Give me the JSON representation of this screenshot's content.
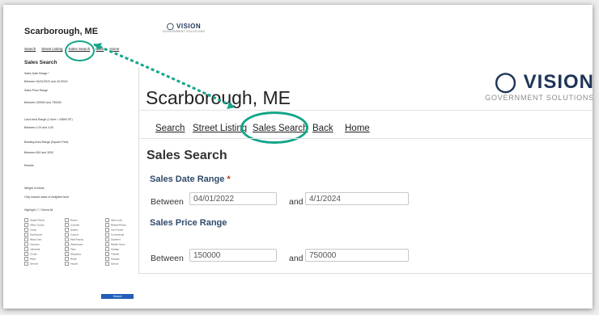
{
  "page": {
    "title": "Scarborough, ME"
  },
  "logo": {
    "brand": "VISION",
    "tagline": "GOVERNMENT SOLUTIONS"
  },
  "nav": {
    "items": [
      "Search",
      "Street Listing",
      "Sales Search",
      "Back",
      "Home"
    ],
    "highlighted": "Sales Search"
  },
  "form": {
    "section_title": "Sales Search",
    "date_range": {
      "label": "Sales Date Range",
      "required_mark": "*",
      "between_label": "Between",
      "and_label": "and",
      "from": "04/01/2022",
      "to": "4/1/2024"
    },
    "price_range": {
      "label": "Sales Price Range",
      "between_label": "Between",
      "and_label": "and",
      "from": "150000",
      "to": "750000"
    }
  },
  "mini": {
    "title": "Scarborough, ME",
    "nav": [
      "Search",
      "Street Listing",
      "Sales Search",
      "Back",
      "Home"
    ],
    "section_title": "Sales Search",
    "rows": [
      "Sales Date Range *",
      "Between  04/01/2022  and  4/1/2024",
      "Sales Price Range",
      "Between  150000  and  750000",
      "Land Area Range (1 Acre = 43560 SF)",
      "Between  1.00  and  4.00",
      "Building Area Range (Square Feet)",
      "Between  500  and  3000",
      "Results",
      "Weight of Areas",
      "Only include sales of weighted land",
      "Highlight / ☐ Check All"
    ],
    "checkboxes": [
      "Single Family",
      "Ranch",
      "Split Level",
      "Cape Cod",
      "Bungalow",
      "Office Condo",
      "Colonial",
      "Raised Ranch",
      "Post Frame",
      "Contemporary",
      "Camp",
      "Duplex",
      "Two Family",
      "Garrison",
      "Cottage",
      "Townhouse",
      "Custom",
      "Commercial",
      "Conventional",
      "Old Style",
      "Mixed Use",
      "Multi Family",
      "Gambrel",
      "Store",
      "Row End",
      "Victorian",
      "Warehouse",
      "Mobile Home",
      "Cabin",
      "Apartment",
      "Industrial",
      "Farm",
      "Garage",
      "Two Story",
      "Cluster",
      "Condo",
      "Shopping",
      "Theater",
      "Hotel",
      "Marina",
      "Motel",
      "Retail",
      "Storage",
      "Resort",
      "Church",
      "Service",
      "Vacant",
      "School",
      "Mill",
      "Other"
    ],
    "submit_label": "Search"
  },
  "accent": "#13a589"
}
